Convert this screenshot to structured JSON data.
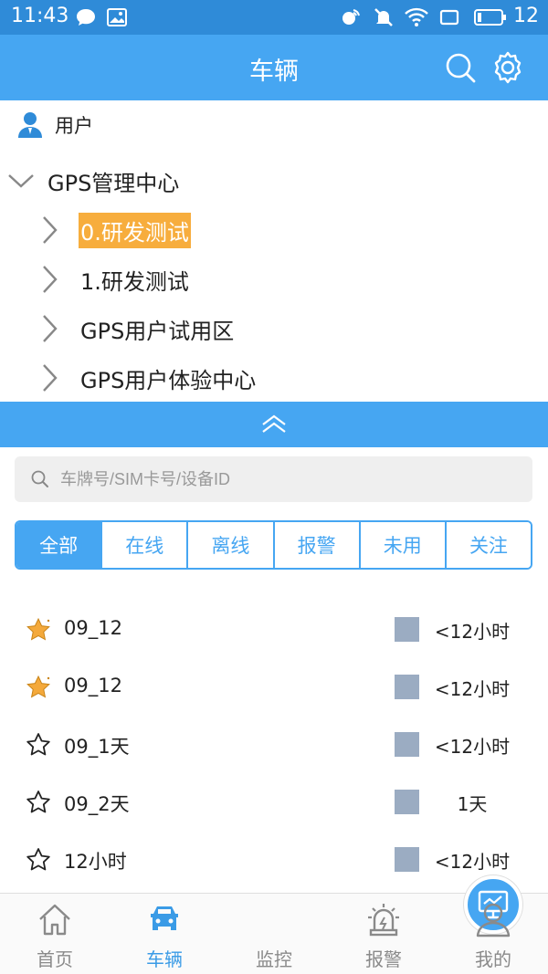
{
  "status_bar": {
    "time": "11:43",
    "battery": "12"
  },
  "header": {
    "title": "车辆"
  },
  "tree": {
    "user_label": "用户",
    "root_label": "GPS管理中心",
    "children": [
      {
        "label": "0.研发测试",
        "selected": true
      },
      {
        "label": "1.研发测试",
        "selected": false
      },
      {
        "label": "GPS用户试用区",
        "selected": false
      },
      {
        "label": "GPS用户体验中心",
        "selected": false
      }
    ]
  },
  "search": {
    "placeholder": "车牌号/SIM卡号/设备ID"
  },
  "tabs": [
    {
      "label": "全部",
      "active": true
    },
    {
      "label": "在线",
      "active": false
    },
    {
      "label": "离线",
      "active": false
    },
    {
      "label": "报警",
      "active": false
    },
    {
      "label": "未用",
      "active": false
    },
    {
      "label": "关注",
      "active": false
    }
  ],
  "vehicles": [
    {
      "name": "09_12",
      "favorite": true,
      "duration": "<12小时"
    },
    {
      "name": "09_12",
      "favorite": true,
      "duration": "<12小时"
    },
    {
      "name": "09_1天",
      "favorite": false,
      "duration": "<12小时"
    },
    {
      "name": "09_2天",
      "favorite": false,
      "duration": "1天"
    },
    {
      "name": "12小时",
      "favorite": false,
      "duration": "<12小时"
    }
  ],
  "bottom_nav": [
    {
      "label": "首页",
      "icon": "home-icon",
      "active": false
    },
    {
      "label": "车辆",
      "icon": "car-icon",
      "active": true
    },
    {
      "label": "监控",
      "icon": "monitor-icon",
      "active": false
    },
    {
      "label": "报警",
      "icon": "alarm-icon",
      "active": false
    },
    {
      "label": "我的",
      "icon": "profile-icon",
      "active": false
    }
  ],
  "colors": {
    "primary": "#46a6f2",
    "status_bar": "#2f8bd8",
    "selected_highlight": "#f7ad3d",
    "favorite_star": "#f4a93b",
    "status_square": "#9bacc2",
    "inactive_nav": "#8a8a8a"
  }
}
